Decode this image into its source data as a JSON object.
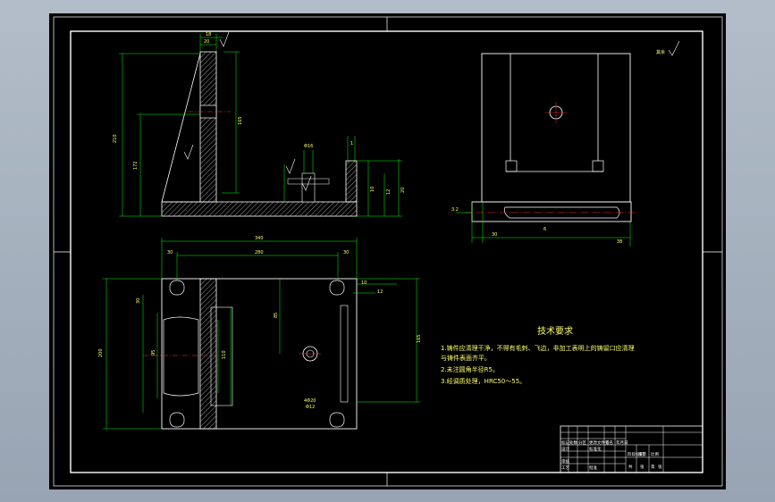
{
  "drawing": {
    "tech_requirements": {
      "title": "技术要求",
      "lines": [
        "1.铸件应清理干净，不得有毛刺、飞边，非加工表明上的铸留口应清理",
        "与铸件表面齐平。",
        "2.未注圆角半径R5。",
        "3.经调质处理，HRC50～55。"
      ]
    },
    "roughness_note": "其余",
    "dimensions": {
      "front_height": "210",
      "front_height2": "172",
      "top_overall": "340",
      "top_inner": "280",
      "top_left": "30",
      "top_right": "30",
      "side_height": "165",
      "right_10": "10",
      "right_12": "12",
      "right_20": "20"
    },
    "title_block": {
      "cells": [
        "标记",
        "处数",
        "分区",
        "更改文件号",
        "签名",
        "年月日",
        "设计",
        "标准化",
        "阶段标记",
        "重量",
        "比例",
        "审核",
        "工艺",
        "批准",
        "共",
        "张",
        "第",
        "张"
      ]
    },
    "colors": {
      "paper": "#000000",
      "line": "#ffffff",
      "dim": "#00ff00",
      "hatch": "#ffffff",
      "center": "#ff0000",
      "text": "#ffff66"
    }
  }
}
